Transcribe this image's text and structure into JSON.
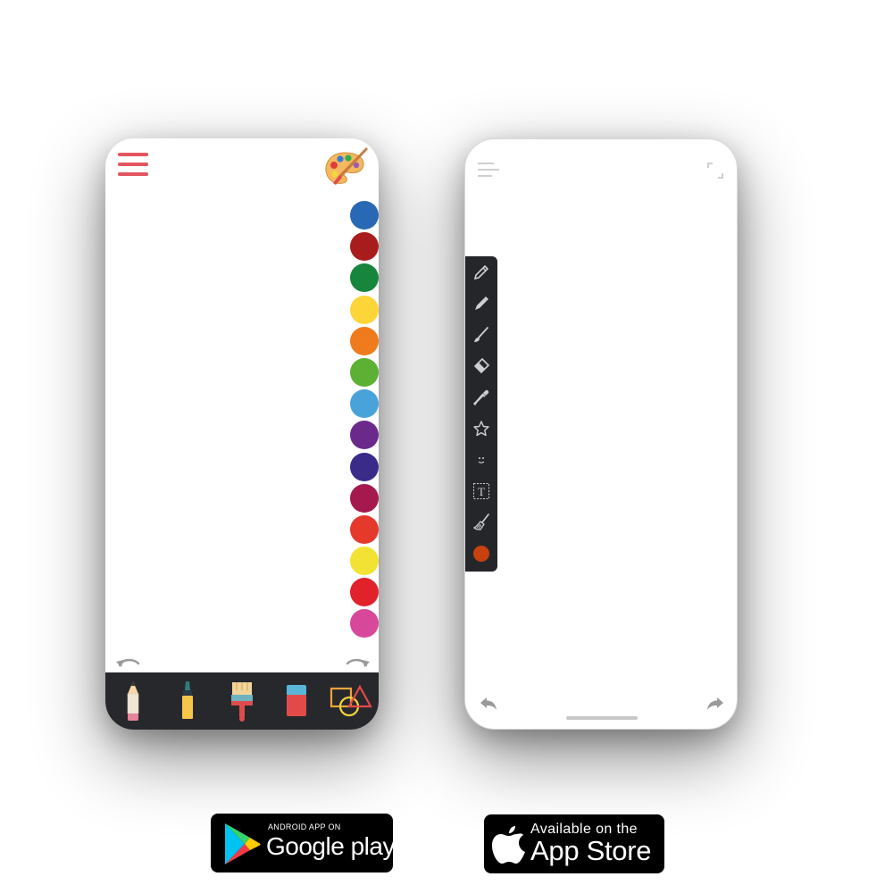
{
  "left_phone": {
    "swatches": [
      "#2968b4",
      "#a91c1e",
      "#17853c",
      "#fdd538",
      "#ef7b1d",
      "#5cb034",
      "#4aa2db",
      "#6b2a8b",
      "#3b2b88",
      "#a5194e",
      "#e5392c",
      "#f2e233",
      "#e2222a",
      "#d8489a"
    ],
    "tools": [
      {
        "name": "pencil-tool",
        "icon": "pencil-icon"
      },
      {
        "name": "marker-tool",
        "icon": "marker-icon"
      },
      {
        "name": "brush-tool",
        "icon": "paintbrush-icon"
      },
      {
        "name": "eraser-tool",
        "icon": "eraser-icon"
      },
      {
        "name": "shapes-tool",
        "icon": "shapes-icon"
      }
    ],
    "accent_color": "#e3555f"
  },
  "right_phone": {
    "side_tools": [
      "pencil-icon",
      "marker-icon",
      "brush-icon",
      "eraser-icon",
      "eyedropper-icon",
      "star-icon",
      "smiley-icon",
      "text-icon",
      "broom-icon"
    ],
    "current_color": "#c8410f",
    "text_tool_glyph": "T"
  },
  "badges": {
    "google": {
      "small": "ANDROID APP ON",
      "big_brand": "Google",
      "big_suffix": " play"
    },
    "apple": {
      "small": "Available on the",
      "big": "App Store"
    }
  }
}
